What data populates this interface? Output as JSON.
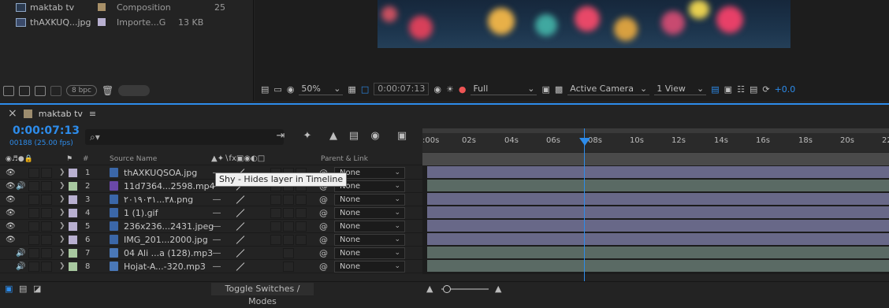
{
  "project": {
    "items": [
      {
        "name": "maktab tv",
        "type": "Composition",
        "size": "",
        "extra": "25",
        "label_color": "#a89068"
      },
      {
        "name": "thAXKUQ...jpg",
        "type": "Importe...G",
        "size": "13 KB",
        "extra": "",
        "label_color": "#b8b0d0"
      }
    ],
    "bpc": "8 bpc"
  },
  "viewer": {
    "zoom": "50%",
    "time": "0:00:07:13",
    "resolution": "Full",
    "camera": "Active Camera",
    "views": "1 View",
    "exposure": "+0.0"
  },
  "timeline": {
    "tab": "maktab tv",
    "timecode": "0:00:07:13",
    "frames": "00188 (25.00 fps)",
    "search_placeholder": "⌕▾",
    "ruler": [
      ":00s",
      "02s",
      "04s",
      "06s",
      "08s",
      "10s",
      "12s",
      "14s",
      "16s",
      "18s",
      "20s",
      "22"
    ],
    "header": {
      "hash": "#",
      "source_name": "Source Name",
      "parent_link": "Parent & Link"
    },
    "layers": [
      {
        "num": "1",
        "name": "thAXKUQSOA.jpg",
        "eye": true,
        "audio": false,
        "swatch": "#b8b0d0",
        "switch": "―",
        "parent": "None",
        "icon": "image"
      },
      {
        "num": "2",
        "name": "11d7364...2598.mp4",
        "eye": true,
        "audio": true,
        "swatch": "#a8c8a0",
        "switch": "―",
        "parent": "None",
        "icon": "video"
      },
      {
        "num": "3",
        "name": "۲۰۱۹۰۳۱...۳۸.png",
        "eye": true,
        "audio": false,
        "swatch": "#b8b0d0",
        "switch": "―",
        "parent": "None",
        "icon": "image"
      },
      {
        "num": "4",
        "name": "1 (1).gif",
        "eye": true,
        "audio": false,
        "swatch": "#b8b0d0",
        "switch": "―",
        "parent": "None",
        "icon": "image"
      },
      {
        "num": "5",
        "name": "236x236...2431.jpeg",
        "eye": true,
        "audio": false,
        "swatch": "#b8b0d0",
        "switch": "―",
        "parent": "None",
        "icon": "image"
      },
      {
        "num": "6",
        "name": "IMG_201...2000.jpg",
        "eye": true,
        "audio": false,
        "swatch": "#b8b0d0",
        "switch": "―",
        "parent": "None",
        "icon": "image"
      },
      {
        "num": "7",
        "name": "04 Ali ...a (128).mp3",
        "eye": false,
        "audio": true,
        "swatch": "#a8c8a0",
        "switch": "―",
        "parent": "None",
        "icon": "audio"
      },
      {
        "num": "8",
        "name": "Hojat-A...-320.mp3",
        "eye": false,
        "audio": true,
        "swatch": "#a8c8a0",
        "switch": "―",
        "parent": "None",
        "icon": "audio"
      }
    ],
    "tooltip": "Shy - Hides layer in Timeline",
    "toggle": "Toggle Switches / Modes",
    "colors": {
      "accent": "#2d8ceb",
      "image_track": "#686888",
      "av_track": "#5a6a64"
    }
  }
}
